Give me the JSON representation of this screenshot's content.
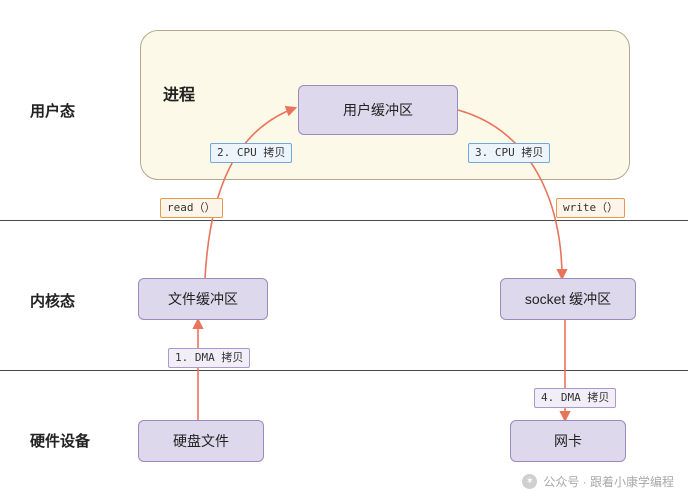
{
  "layers": {
    "user": "用户态",
    "kernel": "内核态",
    "hw": "硬件设备"
  },
  "process": {
    "title": "进程"
  },
  "boxes": {
    "user_buf": "用户缓冲区",
    "file_buf": "文件缓冲区",
    "sock_buf": "socket 缓冲区",
    "disk": "硬盘文件",
    "nic": "网卡"
  },
  "calls": {
    "read": "read（）",
    "write": "write（）"
  },
  "steps": {
    "s1": "1. DMA 拷贝",
    "s2": "2. CPU 拷贝",
    "s3": "3. CPU 拷贝",
    "s4": "4. DMA 拷贝"
  },
  "watermark": "公众号 · 跟着小康学编程",
  "colors": {
    "arrow": "#e9745c"
  }
}
